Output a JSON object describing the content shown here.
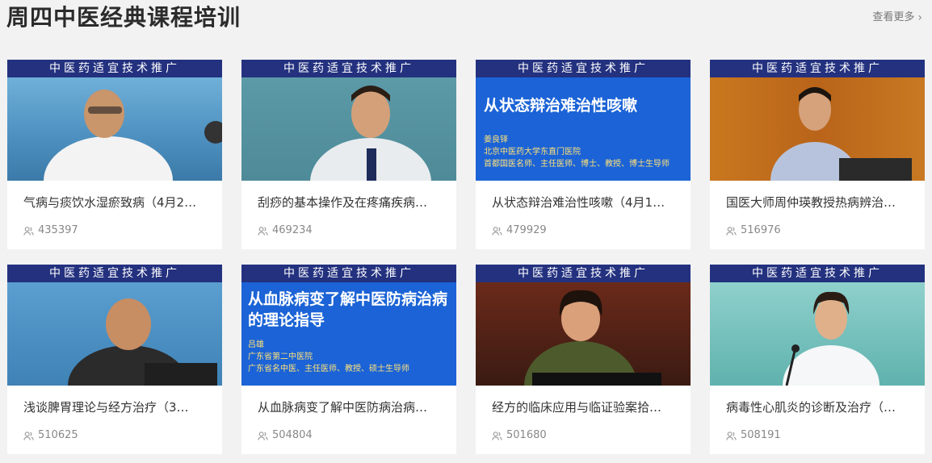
{
  "header": {
    "title": "周四中医经典课程培训",
    "more_label": "查看更多",
    "more_icon": "chevron-right-icon"
  },
  "banner_text": "中医药适宜技术推广",
  "cards": [
    {
      "title": "气病与痰饮水湿瘀致病（4月2…",
      "views": "435397",
      "scene": "bg-blue1"
    },
    {
      "title": "刮痧的基本操作及在疼痛疾病…",
      "views": "469234",
      "scene": "bg-teal"
    },
    {
      "title": "从状态辩治难治性咳嗽（4月1…",
      "views": "479929",
      "scene": "bg-royal",
      "slide": {
        "headline": "从状态辩治难治性咳嗽",
        "lines": [
          "姜良铎",
          "北京中医药大学东直门医院",
          "首都国医名师、主任医师、博士、教授、博士生导师"
        ]
      }
    },
    {
      "title": "国医大师周仲瑛教授热病辨治…",
      "views": "516976",
      "scene": "bg-wood"
    },
    {
      "title": "浅谈脾胃理论与经方治疗（3…",
      "views": "510625",
      "scene": "bg-sky"
    },
    {
      "title": "从血脉病变了解中医防病治病…",
      "views": "504804",
      "scene": "bg-royal",
      "slide": {
        "headline": "从血脉病变了解中医防病治病",
        "headline2": "的理论指导",
        "lines": [
          "吕雄",
          "广东省第二中医院",
          "广东省名中医、主任医师、教授、硕士生导师"
        ]
      }
    },
    {
      "title": "经方的临床应用与临证验案拾…",
      "views": "501680",
      "scene": "bg-dark"
    },
    {
      "title": "病毒性心肌炎的诊断及治疗（…",
      "views": "508191",
      "scene": "bg-mint"
    }
  ],
  "colors": {
    "banner": "#23317f",
    "background": "#f2f2f2",
    "card": "#ffffff",
    "slide_blue": "#1b63d6"
  }
}
